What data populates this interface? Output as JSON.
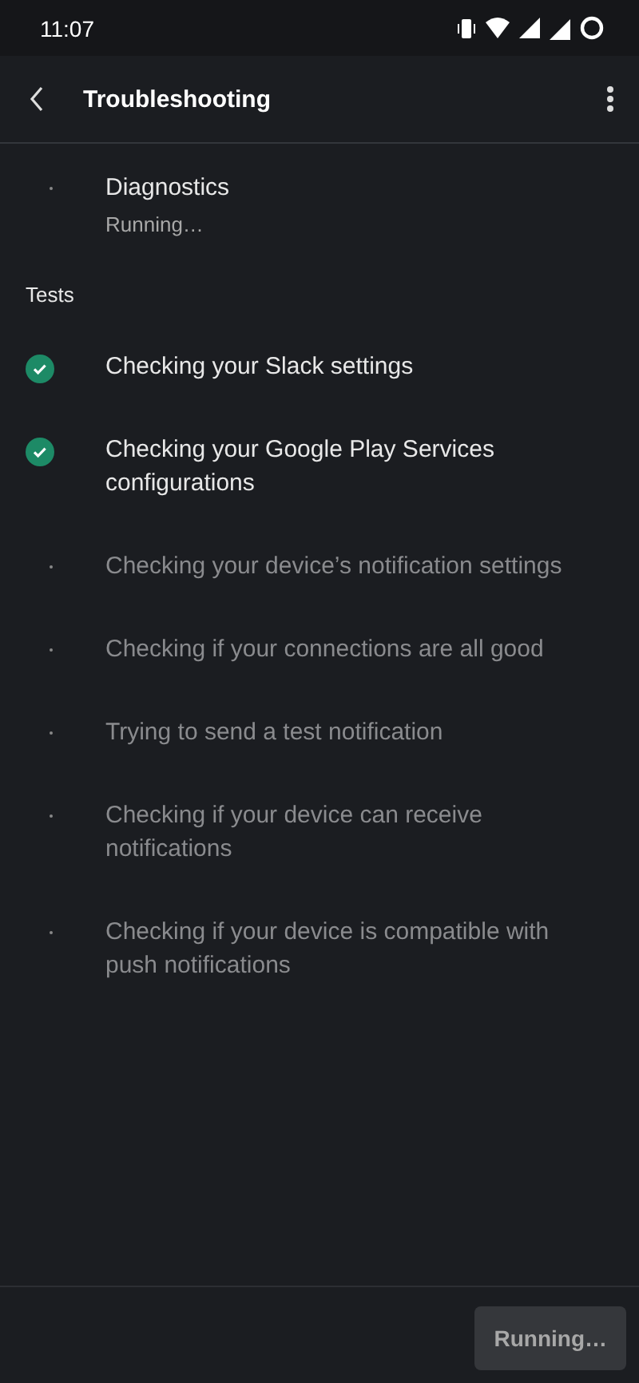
{
  "status_bar": {
    "time": "11:07"
  },
  "app_bar": {
    "title": "Troubleshooting"
  },
  "diagnostics": {
    "title": "Diagnostics",
    "subtitle": "Running…"
  },
  "tests_heading": "Tests",
  "tests": [
    {
      "label": "Checking your Slack settings",
      "done": true
    },
    {
      "label": "Checking your Google Play Services configurations",
      "done": true
    },
    {
      "label": "Checking your device’s notification settings",
      "done": false
    },
    {
      "label": "Checking if your connections are all good",
      "done": false
    },
    {
      "label": "Trying to send a test notification",
      "done": false
    },
    {
      "label": "Checking if your device can receive notifications",
      "done": false
    },
    {
      "label": "Checking if your device is compatible with push notifications",
      "done": false
    }
  ],
  "footer": {
    "button": "Running…",
    "disabled": true
  }
}
